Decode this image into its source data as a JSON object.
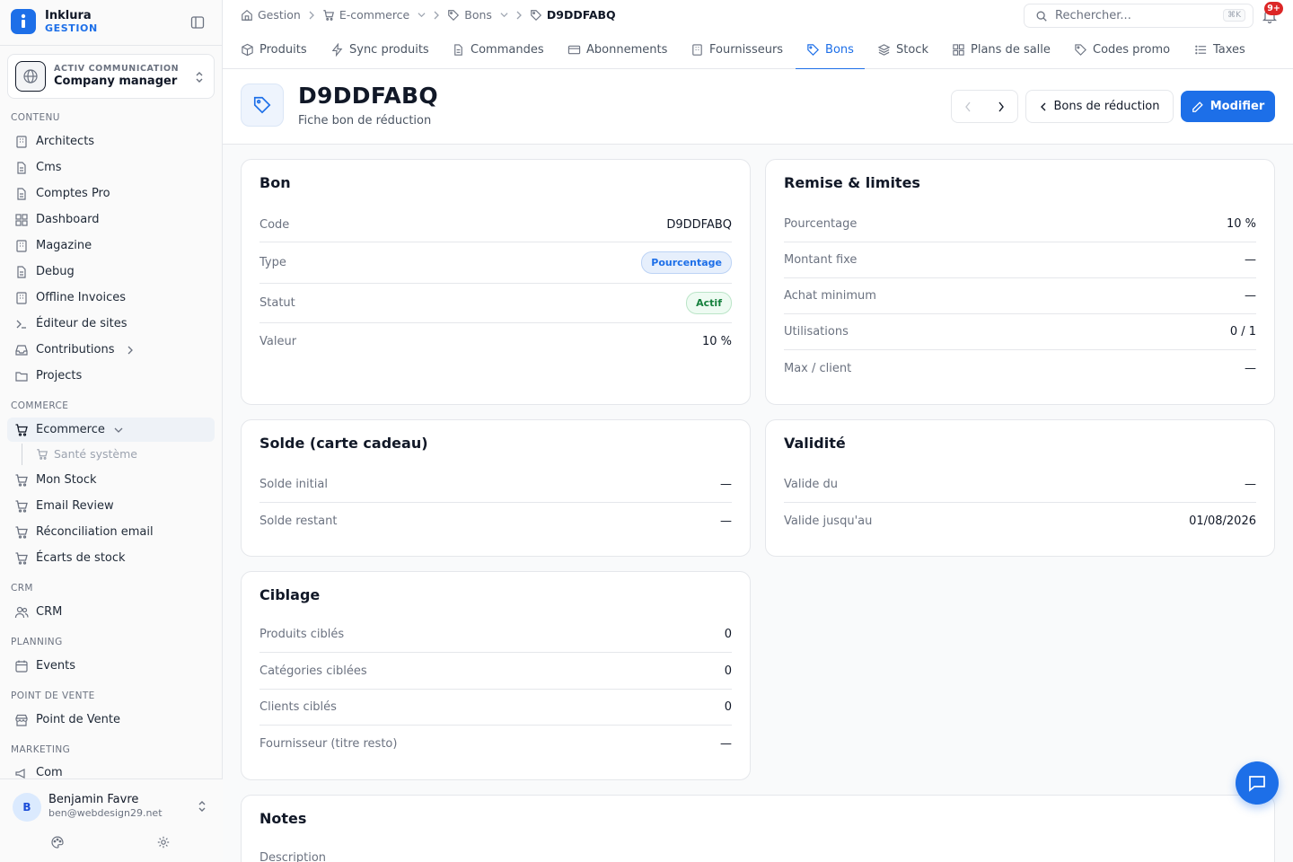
{
  "brand": {
    "name": "Inklura",
    "sub": "GESTION"
  },
  "org": {
    "kicker": "ACTIV COMMUNICATION",
    "name": "Company manager"
  },
  "sections": {
    "contenu": "CONTENU",
    "commerce": "COMMERCE",
    "crm": "CRM",
    "planning": "PLANNING",
    "pos": "POINT DE VENTE",
    "marketing": "MARKETING"
  },
  "nav": {
    "architects": "Architects",
    "cms": "Cms",
    "comptes_pro": "Comptes Pro",
    "dashboard": "Dashboard",
    "magazine": "Magazine",
    "debug": "Debug",
    "offline_invoices": "Offline Invoices",
    "editeur": "Éditeur de sites",
    "contributions": "Contributions",
    "projects": "Projects",
    "ecommerce": "Ecommerce",
    "sante": "Santé système",
    "mon_stock": "Mon Stock",
    "email_review": "Email Review",
    "reconciliation": "Réconciliation email",
    "ecarts": "Écarts de stock",
    "crm": "CRM",
    "events": "Events",
    "pos": "Point de Vente",
    "com": "Com"
  },
  "user": {
    "initial": "B",
    "name": "Benjamin Favre",
    "email": "ben@webdesign29.net"
  },
  "breadcrumb": {
    "gestion": "Gestion",
    "ecommerce": "E-commerce",
    "bons": "Bons",
    "current": "D9DDFABQ"
  },
  "search": {
    "placeholder": "Rechercher...",
    "shortcut": "⌘K"
  },
  "notifications": {
    "badge": "9+"
  },
  "tabs": {
    "produits": "Produits",
    "sync": "Sync produits",
    "commandes": "Commandes",
    "abonnements": "Abonnements",
    "fournisseurs": "Fournisseurs",
    "bons": "Bons",
    "stock": "Stock",
    "plans": "Plans de salle",
    "codes": "Codes promo",
    "taxes": "Taxes"
  },
  "header": {
    "title": "D9DDFABQ",
    "subtitle": "Fiche bon de réduction",
    "back_label": "Bons de réduction",
    "edit_label": "Modifier"
  },
  "bon": {
    "title": "Bon",
    "code_label": "Code",
    "code_value": "D9DDFABQ",
    "type_label": "Type",
    "type_value": "Pourcentage",
    "statut_label": "Statut",
    "statut_value": "Actif",
    "valeur_label": "Valeur",
    "valeur_value": "10 %"
  },
  "remise": {
    "title": "Remise & limites",
    "pourcentage_label": "Pourcentage",
    "pourcentage_value": "10 %",
    "montant_label": "Montant fixe",
    "montant_value": "—",
    "achat_label": "Achat minimum",
    "achat_value": "—",
    "utilisations_label": "Utilisations",
    "utilisations_value": "0 / 1",
    "max_label": "Max / client",
    "max_value": "—"
  },
  "solde": {
    "title": "Solde (carte cadeau)",
    "initial_label": "Solde initial",
    "initial_value": "—",
    "restant_label": "Solde restant",
    "restant_value": "—"
  },
  "validite": {
    "title": "Validité",
    "du_label": "Valide du",
    "du_value": "—",
    "jusqu_label": "Valide jusqu'au",
    "jusqu_value": "01/08/2026"
  },
  "ciblage": {
    "title": "Ciblage",
    "produits_label": "Produits ciblés",
    "produits_value": "0",
    "categories_label": "Catégories ciblées",
    "categories_value": "0",
    "clients_label": "Clients ciblés",
    "clients_value": "0",
    "fournisseur_label": "Fournisseur (titre resto)",
    "fournisseur_value": "—"
  },
  "notes": {
    "title": "Notes",
    "description_label": "Description"
  },
  "colors": {
    "accent": "#1d6fe8",
    "badge": "#dc2626",
    "active_green": "#15803d"
  }
}
